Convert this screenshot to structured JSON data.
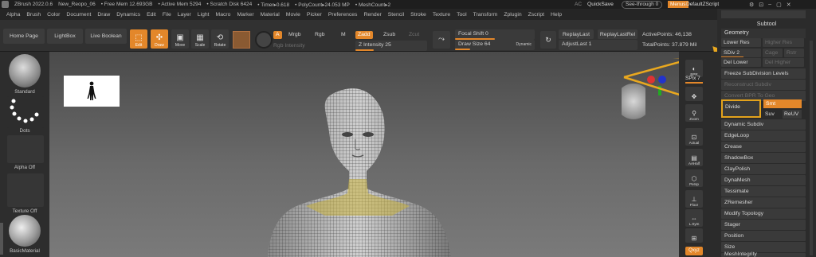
{
  "titlebar": {
    "app": "ZBrush 2022.0.6",
    "project": "New_Reopo_06",
    "free_mem": "• Free Mem 12.693GB",
    "active_mem": "• Active Mem 5294",
    "scratch_disk": "• Scratch Disk 6424",
    "timer": "• Timer▸0.618",
    "poly_count": "• PolyCount▸24.053 MP",
    "mesh_count": "• MeshCount▸2",
    "ac": "AC",
    "quicksave": "QuickSave",
    "see_through": "See-through  0",
    "menus": "Menus",
    "default_zscript": "DefaultZScript"
  },
  "menubar": [
    "Alpha",
    "Brush",
    "Color",
    "Document",
    "Draw",
    "Dynamics",
    "Edit",
    "File",
    "Layer",
    "Light",
    "Macro",
    "Marker",
    "Material",
    "Movie",
    "Picker",
    "Preferences",
    "Render",
    "Stencil",
    "Stroke",
    "Texture",
    "Tool",
    "Transform",
    "Zplugin",
    "Zscript",
    "Help"
  ],
  "shelf": {
    "home_page": "Home Page",
    "lightbox": "LightBox",
    "live_boolean": "Live Boolean",
    "edit": "Edit",
    "draw": "Draw",
    "move": "Move",
    "scale": "Scale",
    "rotate": "Rotate",
    "a": "A",
    "mrgb": "Mrgb",
    "rgb": "Rgb",
    "m": "M",
    "rgb_intensity": "Rgb Intensity",
    "zadd": "Zadd",
    "zsub": "Zsub",
    "zcut": "Zcut",
    "z_intensity": "Z Intensity 25",
    "z_intensity_value": 25,
    "focal_shift": "Focal Shift 0",
    "draw_size": "Draw Size 64",
    "draw_size_value": 64,
    "dynamic": "Dynamic",
    "replay_last": "ReplayLast",
    "replay_last_rel": "ReplayLastRel",
    "adjust_last": "AdjustLast 1",
    "active_points": "ActivePoints: 46,138",
    "total_points": "TotalPoints: 37.879 Mil"
  },
  "leftpanel": {
    "standard": "Standard",
    "dots": "Dots",
    "alpha_off": "Alpha Off",
    "texture_off": "Texture Off",
    "basic_material": "BasicMaterial"
  },
  "rightstrip": {
    "bpr": "BPR",
    "spix": "SPix 7",
    "zoom": "Zoom",
    "actual": "Actual",
    "aahalf": "AAHalf",
    "persp": "Persp",
    "floor": "Floor",
    "lsym": "L.Sym",
    "xyz": "Qxyz",
    "xyz_label": "◦ xyz"
  },
  "sidepanel": {
    "subtool": "Subtool",
    "geometry": "Geometry",
    "lower_res": "Lower Res",
    "higher_res": "Higher Res",
    "sdiv": "SDiv 2",
    "cage": "Cage",
    "rstr": "Rstr",
    "del_lower": "Del Lower",
    "del_higher": "Del Higher",
    "freeze": "Freeze SubDivision Levels",
    "reconstruct": "Reconstruct Subdiv",
    "convert_bpr": "Convert BPR To Geo",
    "divide": "Divide",
    "smt": "Smt",
    "suv": "Suv",
    "reuv": "ReUV",
    "items": [
      "Dynamic Subdiv",
      "EdgeLoop",
      "Crease",
      "ShadowBox",
      "ClayPolish",
      "DynaMesh",
      "Tessimate",
      "ZRemesher",
      "Modify Topology",
      "Stager",
      "Position",
      "Size",
      "MeshIntegrity"
    ]
  },
  "colors": {
    "accent": "#e3872a",
    "panel": "#2b2b2b",
    "button": "#3a3a3a"
  }
}
